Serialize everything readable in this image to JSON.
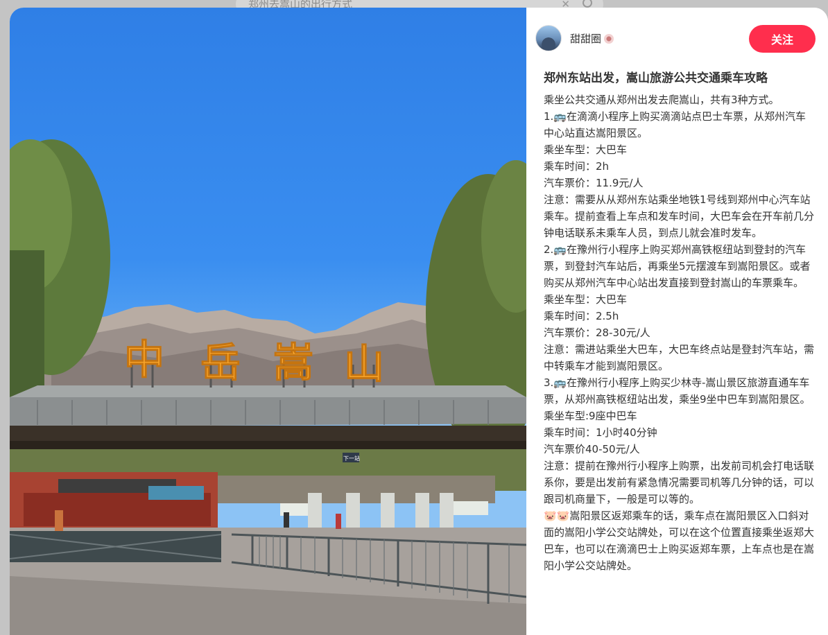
{
  "background": {
    "search_text": "郑州去嵩山的出行方式"
  },
  "author": {
    "name": "甜甜圈"
  },
  "follow_label": "关注",
  "photo": {
    "sign_chars": [
      "中",
      "岳",
      "嵩",
      "山"
    ],
    "station_sign": "下一站"
  },
  "post": {
    "title": "郑州东站出发，嵩山旅游公共交通乘车攻略",
    "body": "乘坐公共交通从郑州出发去爬嵩山，共有3种方式。\n1.🚌在滴滴小程序上购买滴滴站点巴士车票，从郑州汽车中心站直达嵩阳景区。\n乘坐车型：大巴车\n乘车时间：2h\n汽车票价：11.9元/人\n注意：需要从从郑州东站乘坐地铁1号线到郑州中心汽车站乘车。提前查看上车点和发车时间，大巴车会在开车前几分钟电话联系未乘车人员，到点儿就会准时发车。\n2.🚌在豫州行小程序上购买郑州高铁枢纽站到登封的汽车票，到登封汽车站后，再乘坐5元摆渡车到嵩阳景区。或者购买从郑州汽车中心站出发直接到登封嵩山的车票乘车。\n乘坐车型：大巴车\n乘车时间：2.5h\n汽车票价：28-30元/人\n注意：需进站乘坐大巴车，大巴车终点站是登封汽车站，需中转乘车才能到嵩阳景区。\n3.🚌在豫州行小程序上购买少林寺-嵩山景区旅游直通车车票，从郑州高铁枢纽站出发，乘坐9坐中巴车到嵩阳景区。\n乘坐车型:9座中巴车\n乘车时间：1小时40分钟\n汽车票价40-50元/人\n注意：提前在豫州行小程序上购票，出发前司机会打电话联系你，要是出发前有紧急情况需要司机等几分钟的话，可以跟司机商量下，一般是可以等的。\n🐷🐷嵩阳景区返郑乘车的话，乘车点在嵩阳景区入口斜对面的嵩阳小学公交站牌处，可以在这个位置直接乘坐返郑大巴车，也可以在滴滴巴士上购买返郑车票，上车点也是在嵩阳小学公交站牌处。"
  }
}
